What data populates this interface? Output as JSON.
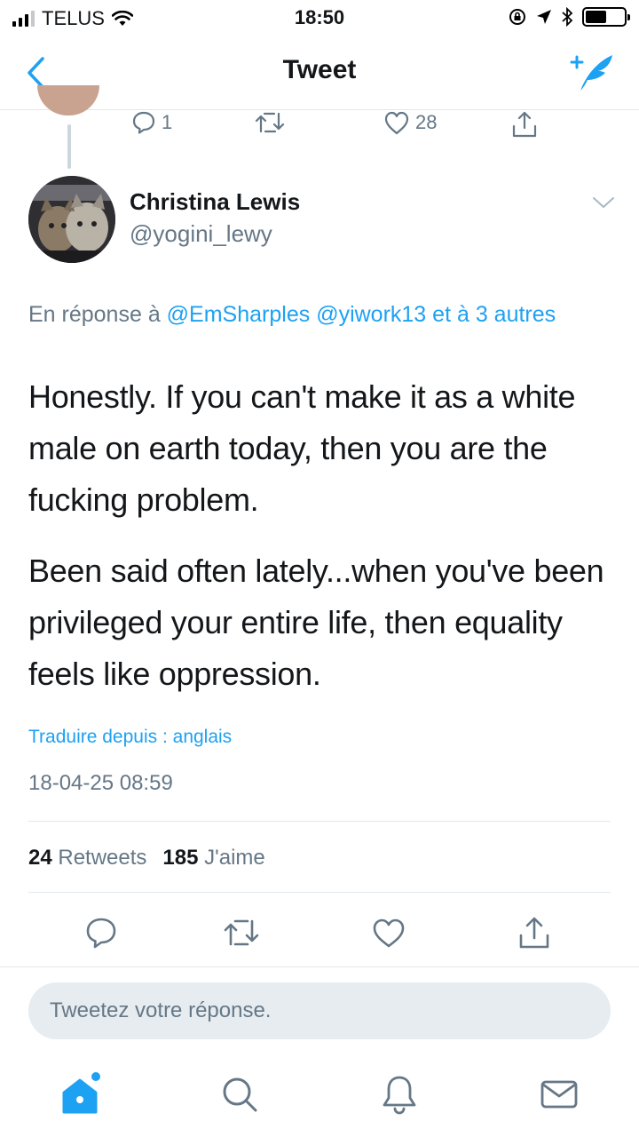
{
  "status_bar": {
    "carrier": "TELUS",
    "time": "18:50",
    "signal_bars_filled": 3,
    "signal_bars_total": 4,
    "battery_level": 0.55
  },
  "nav": {
    "title": "Tweet",
    "back_icon": "chevron-left-icon",
    "compose_icon": "compose-tweet-icon"
  },
  "previous_tweet": {
    "reply_count": "1",
    "like_count": "28"
  },
  "tweet": {
    "author_name": "Christina Lewis",
    "author_handle": "@yogini_lewy",
    "reply_prefix": "En réponse à",
    "mention_1": "@EmSharples",
    "mention_2": "@yiwork13",
    "reply_suffix": "et à 3 autres",
    "text_paragraph_1": "Honestly. If you can't make it as a white male on earth today, then you are the fucking problem.",
    "text_paragraph_2": "Been said often lately...when you've been privileged your entire life, then equality feels like oppression.",
    "translate_link": "Traduire depuis : anglais",
    "timestamp": "18-04-25 08:59",
    "retweet_count": "24",
    "retweet_label": "Retweets",
    "like_count": "185",
    "like_label": "J'aime"
  },
  "reply_box": {
    "placeholder": "Tweetez votre réponse."
  },
  "tab_bar": {
    "tabs": [
      "home-icon",
      "search-icon",
      "notifications-icon",
      "messages-icon"
    ],
    "active": "home-icon"
  },
  "colors": {
    "accent": "#1da1f2",
    "secondary_text": "#657786",
    "primary_text": "#14171a",
    "divider": "#e1e8ed"
  }
}
